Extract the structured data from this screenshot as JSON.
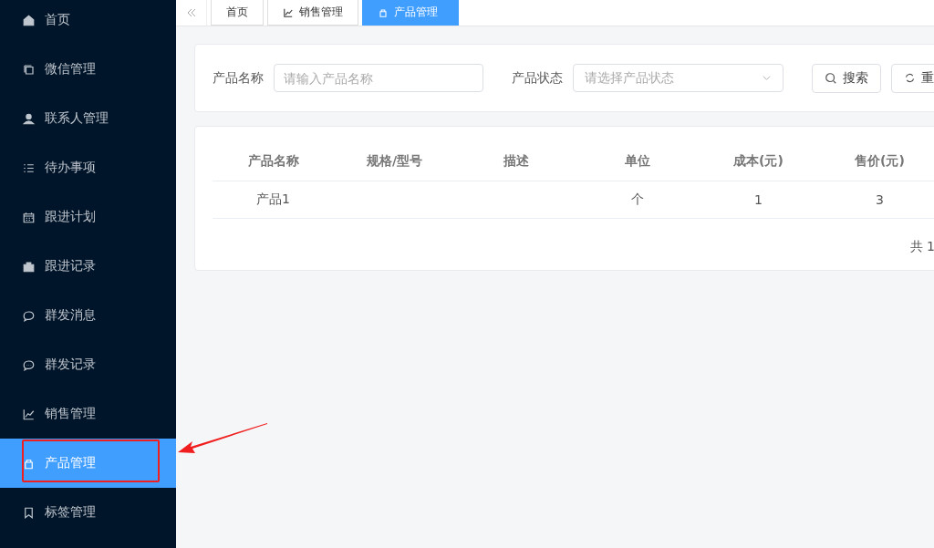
{
  "sidebar": {
    "items": [
      {
        "label": "首页",
        "selected": false
      },
      {
        "label": "微信管理",
        "selected": false
      },
      {
        "label": "联系人管理",
        "selected": false
      },
      {
        "label": "待办事项",
        "selected": false
      },
      {
        "label": "跟进计划",
        "selected": false
      },
      {
        "label": "跟进记录",
        "selected": false
      },
      {
        "label": "群发消息",
        "selected": false
      },
      {
        "label": "群发记录",
        "selected": false
      },
      {
        "label": "销售管理",
        "selected": false
      },
      {
        "label": "产品管理",
        "selected": true
      },
      {
        "label": "标签管理",
        "selected": false
      }
    ]
  },
  "tabs": [
    {
      "label": "首页",
      "selected": false
    },
    {
      "label": "销售管理",
      "selected": false
    },
    {
      "label": "产品管理",
      "selected": true
    }
  ],
  "search": {
    "name_label": "产品名称",
    "name_placeholder": "请输入产品名称",
    "status_label": "产品状态",
    "status_placeholder": "请选择产品状态",
    "search_button": "搜索",
    "reset_button": "重"
  },
  "table": {
    "columns": [
      "产品名称",
      "规格/型号",
      "描述",
      "单位",
      "成本(元)",
      "售价(元)"
    ],
    "rows": [
      [
        "产品1",
        "",
        "",
        "个",
        "1",
        "3"
      ]
    ]
  },
  "pagination": {
    "total": "共 1"
  }
}
